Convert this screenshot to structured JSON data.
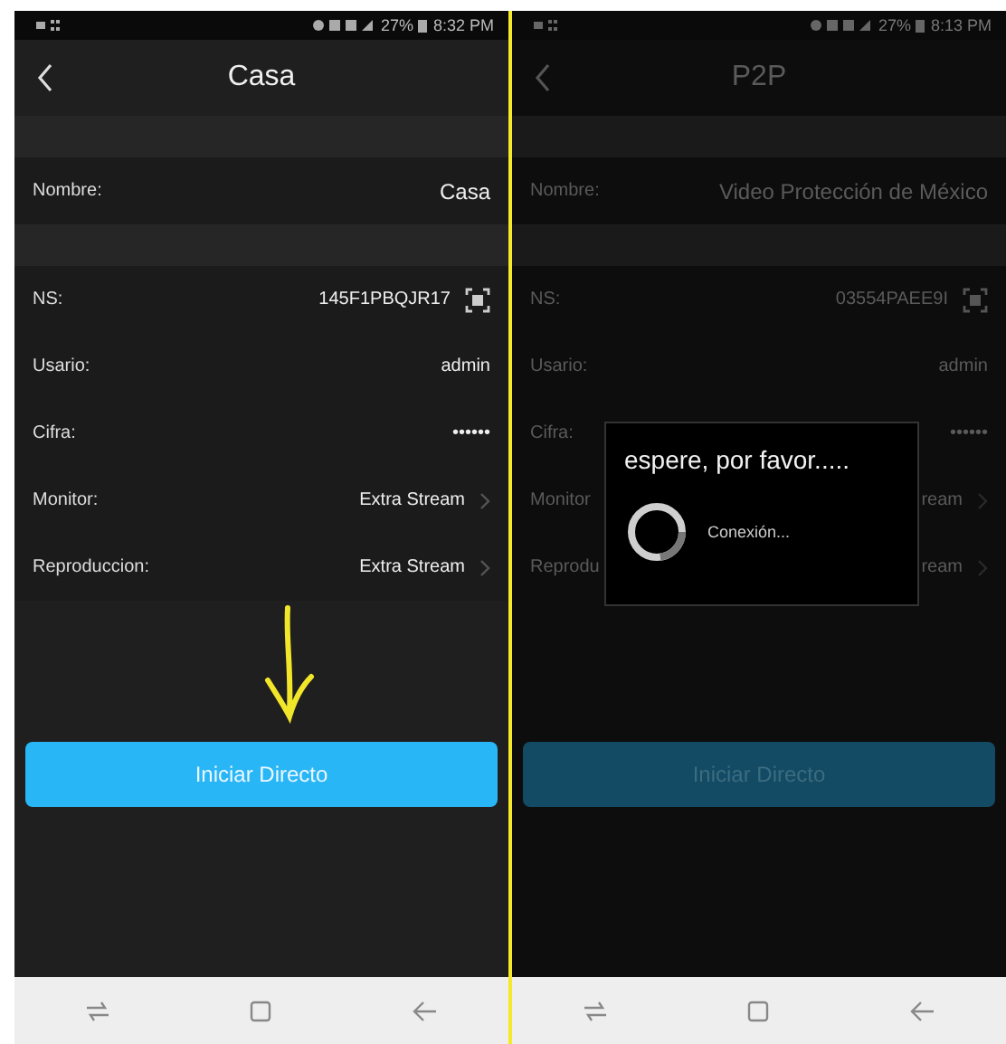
{
  "screens": [
    {
      "status_bar": {
        "battery": "27%",
        "time": "8:32 PM"
      },
      "title": "Casa",
      "dimmed": false,
      "arrow_annotation": true,
      "groups": [
        [
          {
            "label": "Nombre:",
            "value": "Casa",
            "kind": "text"
          }
        ],
        [
          {
            "label": "NS:",
            "value": "145F1PBQJR17",
            "kind": "qr"
          },
          {
            "label": "Usario:",
            "value": "admin",
            "kind": "text"
          },
          {
            "label": "Cifra:",
            "value": "••••••",
            "kind": "text"
          },
          {
            "label": "Monitor:",
            "value": "Extra Stream",
            "kind": "chevron"
          },
          {
            "label": "Reproduccion:",
            "value": "Extra Stream",
            "kind": "chevron"
          }
        ]
      ],
      "button": {
        "label": "Iniciar Directo",
        "disabled": false
      }
    },
    {
      "status_bar": {
        "battery": "27%",
        "time": "8:13 PM"
      },
      "title": "P2P",
      "dimmed": true,
      "arrow_annotation": false,
      "groups": [
        [
          {
            "label": "Nombre:",
            "value": "Video Protección de México",
            "kind": "text"
          }
        ],
        [
          {
            "label": "NS:",
            "value": "03554PAEE9I",
            "kind": "qr"
          },
          {
            "label": "Usario:",
            "value": "admin",
            "kind": "text"
          },
          {
            "label": "Cifra:",
            "value": "••••••",
            "kind": "text"
          },
          {
            "label": "Monitor",
            "value": "ream",
            "kind": "chevron"
          },
          {
            "label": "Reprodu",
            "value": "ream",
            "kind": "chevron"
          }
        ]
      ],
      "button": {
        "label": "Iniciar Directo",
        "disabled": true
      },
      "dialog": {
        "title": "espere, por favor.....",
        "message": "Conexión..."
      }
    }
  ]
}
